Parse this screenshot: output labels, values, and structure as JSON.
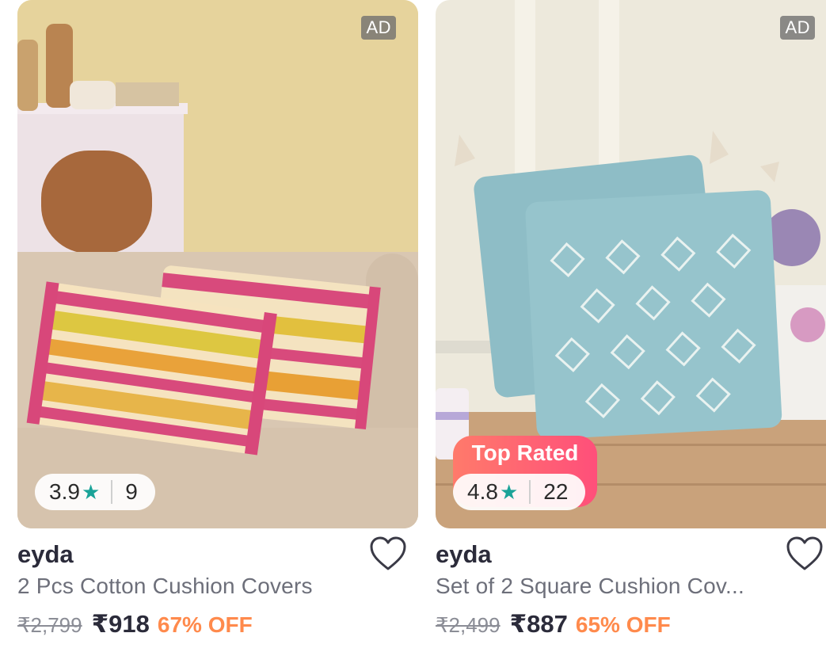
{
  "products": [
    {
      "ad_label": "AD",
      "rating": "3.9",
      "rating_count": "9",
      "badge": "",
      "brand": "eyda",
      "title": "2 Pcs Cotton Cushion Covers",
      "mrp": "₹2,799",
      "price": "₹918",
      "discount": "67% OFF",
      "icons": [
        "star-icon",
        "heart-icon"
      ]
    },
    {
      "ad_label": "AD",
      "rating": "4.8",
      "rating_count": "22",
      "badge": "Top Rated",
      "brand": "eyda",
      "title": "Set of 2 Square Cushion Cov...",
      "mrp": "₹2,499",
      "price": "₹887",
      "discount": "65% OFF",
      "icons": [
        "star-icon",
        "heart-icon"
      ]
    }
  ],
  "colors": {
    "rating_star": "#1aa398",
    "discount": "#ff8a4c",
    "top_rated_gradient": [
      "#ff7a6b",
      "#ff4f7a"
    ]
  }
}
